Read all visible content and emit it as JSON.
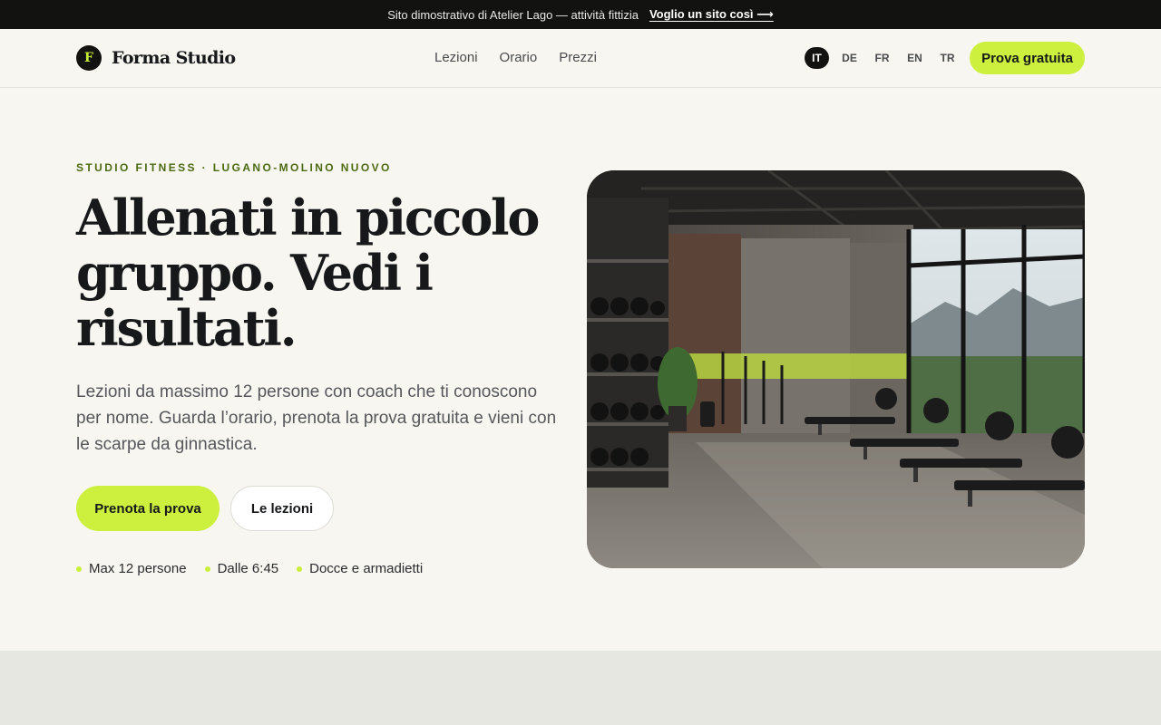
{
  "promo": {
    "text": "Sito dimostrativo di Atelier Lago — attività fittizia",
    "link": "Voglio un sito così ⟶"
  },
  "nav": {
    "logo_letter": "F",
    "brand": "Forma Studio",
    "links": [
      "Lezioni",
      "Orario",
      "Prezzi"
    ],
    "languages": [
      "IT",
      "DE",
      "FR",
      "EN",
      "TR"
    ],
    "active_language": "IT",
    "cta": "Prova gratuita"
  },
  "hero": {
    "eyebrow": "STUDIO FITNESS · LUGANO-MOLINO NUOVO",
    "headline": "Allenati in piccolo gruppo. Vedi i risultati.",
    "lead": "Lezioni da massimo 12 persone con coach che ti conoscono per nome. Guarda l’orario, prenota la prova gratuita e vieni con le scarpe da ginnastica.",
    "primary_cta": "Prenota la prova",
    "secondary_cta": "Le lezioni",
    "features": [
      "Max 12 persone",
      "Dalle 6:45",
      "Docce e armadietti"
    ]
  },
  "colors": {
    "accent": "#ccf03d",
    "dark": "#121211",
    "background": "#f7f6f1",
    "eyebrow": "#4d6a12"
  },
  "icons": {
    "list_marker": "green-dot-icon"
  }
}
